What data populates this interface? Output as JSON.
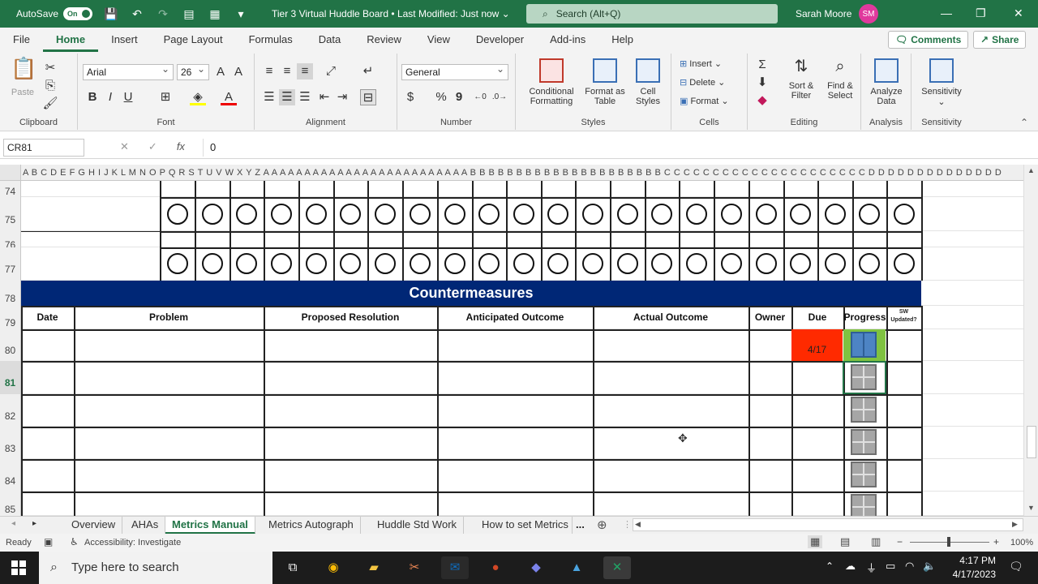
{
  "titlebar": {
    "autosave_label": "AutoSave",
    "autosave_state": "On",
    "title": "Tier 3 Virtual Huddle Board • Last Modified: Just now",
    "search_placeholder": "Search (Alt+Q)",
    "user_name": "Sarah Moore",
    "user_initials": "SM"
  },
  "ribbon_tabs": [
    "File",
    "Home",
    "Insert",
    "Page Layout",
    "Formulas",
    "Data",
    "Review",
    "View",
    "Developer",
    "Add-ins",
    "Help"
  ],
  "ribbon_actions": {
    "comments": "Comments",
    "share": "Share"
  },
  "ribbon": {
    "clipboard": {
      "paste": "Paste",
      "label": "Clipboard"
    },
    "font": {
      "name": "Arial",
      "size": "26",
      "bold": "B",
      "italic": "I",
      "underline": "U",
      "label": "Font"
    },
    "alignment": {
      "label": "Alignment"
    },
    "number": {
      "format": "General",
      "currency": "$",
      "percent": "%",
      "comma": "9",
      "label": "Number"
    },
    "styles": {
      "conditional": "Conditional",
      "formatting": "Formatting",
      "format_as": "Format as",
      "table": "Table",
      "cell": "Cell",
      "styles_word": "Styles",
      "label": "Styles"
    },
    "cells": {
      "insert": "Insert",
      "delete": "Delete",
      "format": "Format",
      "label": "Cells"
    },
    "editing": {
      "sort": "Sort &",
      "filter": "Filter",
      "find": "Find &",
      "select": "Select",
      "label": "Editing"
    },
    "analysis": {
      "analyze": "Analyze",
      "data": "Data",
      "label": "Analysis"
    },
    "sensitivity": {
      "button": "Sensitivity",
      "label": "Sensitivity"
    }
  },
  "formula_bar": {
    "name_box": "CR81",
    "fx": "fx",
    "value": "0"
  },
  "grid": {
    "column_header_text": "A B C D E F G H I J K L M N O P Q R S T U V W X Y Z A A A A A A A A A A A A A A A A A A A A A A A A A B B B B B B B B B B B B B B B B B B B B B C C C C C C C C C C C C C C C C C C C C C D D D D D D D D D D D D D D",
    "rows": [
      "74",
      "75",
      "76",
      "77",
      "78",
      "79",
      "80",
      "81",
      "82",
      "83",
      "84",
      "85"
    ],
    "banner": "Countermeasures",
    "headers": [
      "Date",
      "Problem",
      "Proposed Resolution",
      "Anticipated Outcome",
      "Actual Outcome",
      "Owner",
      "Due",
      "Progress"
    ],
    "sw_updated": [
      "SW",
      "Updated?"
    ],
    "due_value": "4/17",
    "first_progress_fraction": 0.5
  },
  "sheet_tabs": [
    "Overview",
    "AHAs",
    "Metrics Manual",
    "Metrics Autograph",
    "Huddle Std Work",
    "How to set Metrics ("
  ],
  "sheet_more": "...",
  "status": {
    "ready": "Ready",
    "accessibility": "Accessibility: Investigate",
    "zoom": "100%"
  },
  "taskbar": {
    "search_placeholder": "Type here to search",
    "time": "4:17 PM",
    "date": "4/17/2023"
  },
  "colors": {
    "excel_green": "#217346",
    "banner_navy": "#002776",
    "due_red": "#ff2a00",
    "progress_green": "#7fc241",
    "progress_blue": "#4d84c4"
  }
}
